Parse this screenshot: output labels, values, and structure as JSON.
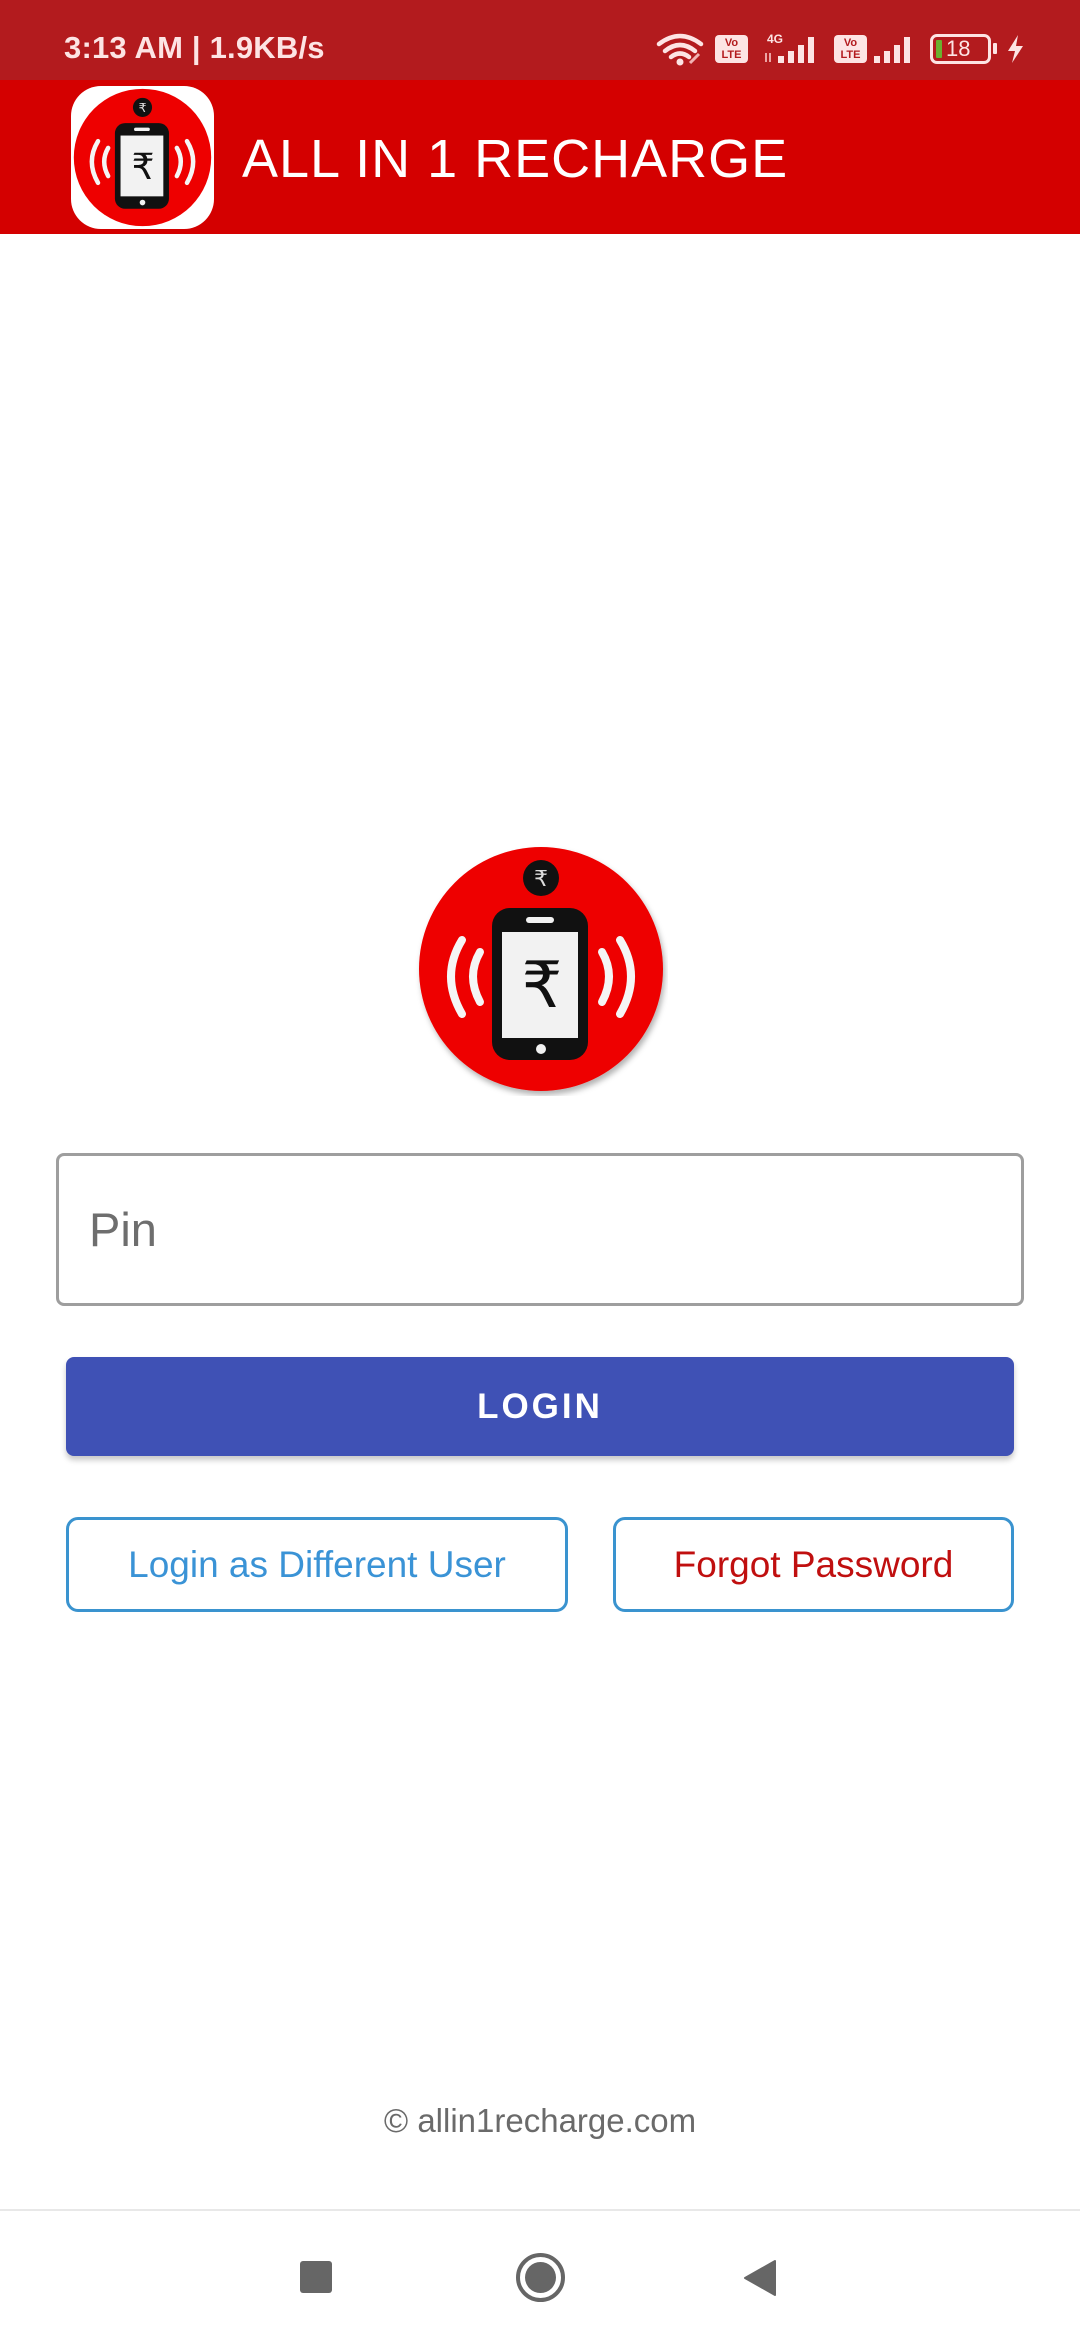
{
  "status_bar": {
    "time_speed": "3:13 AM | 1.9KB/s",
    "icons": [
      "wifi-icon",
      "volte-icon",
      "signal-4g-icon",
      "volte-icon",
      "signal-icon",
      "battery-icon",
      "charging-icon"
    ],
    "network_label": "4G",
    "volte_label_top": "Vo",
    "volte_label_bottom": "LTE",
    "battery_level": "18",
    "battery_fill_color": "#6ab02f"
  },
  "app_bar": {
    "title": "ALL IN 1 RECHARGE",
    "background": "#d40000"
  },
  "logo": {
    "icon": "phone-rupee-logo",
    "rupee_symbol": "₹"
  },
  "login_form": {
    "pin_placeholder": "Pin",
    "pin_value": "",
    "login_label": "LOGIN",
    "login_color": "#3f51b5",
    "different_user_label": "Login as Different User",
    "forgot_password_label": "Forgot Password"
  },
  "footer": {
    "copyright": "© allin1recharge.com"
  },
  "nav_bar": {
    "buttons": [
      "recents-icon",
      "home-icon",
      "back-icon"
    ]
  }
}
